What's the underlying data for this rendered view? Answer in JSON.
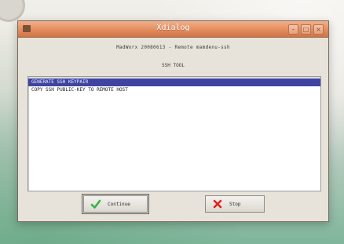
{
  "window": {
    "title": "Xdialog",
    "menu_icon": "window-menu-icon",
    "controls": {
      "minimize_icon": "minimize-icon",
      "maximize_icon": "maximize-icon",
      "close_icon": "close-icon"
    }
  },
  "dialog": {
    "backtitle": "MadWorx 20080613 - Remote mamdenu-ssh",
    "menu_title": "SSH TOOL",
    "items": [
      {
        "label": "GENERATE SSH KEYPAIR",
        "selected": true
      },
      {
        "label": "COPY SSH PUBLIC-KEY TO REMOTE HOST",
        "selected": false
      }
    ]
  },
  "buttons": {
    "continue": {
      "label": "Continue",
      "icon": "check-icon"
    },
    "stop": {
      "label": "Stop",
      "icon": "cross-icon"
    }
  },
  "colors": {
    "titlebar": "#e38c5d",
    "selection": "#3f44a0",
    "check": "#37b34a",
    "cross": "#e2231a"
  }
}
